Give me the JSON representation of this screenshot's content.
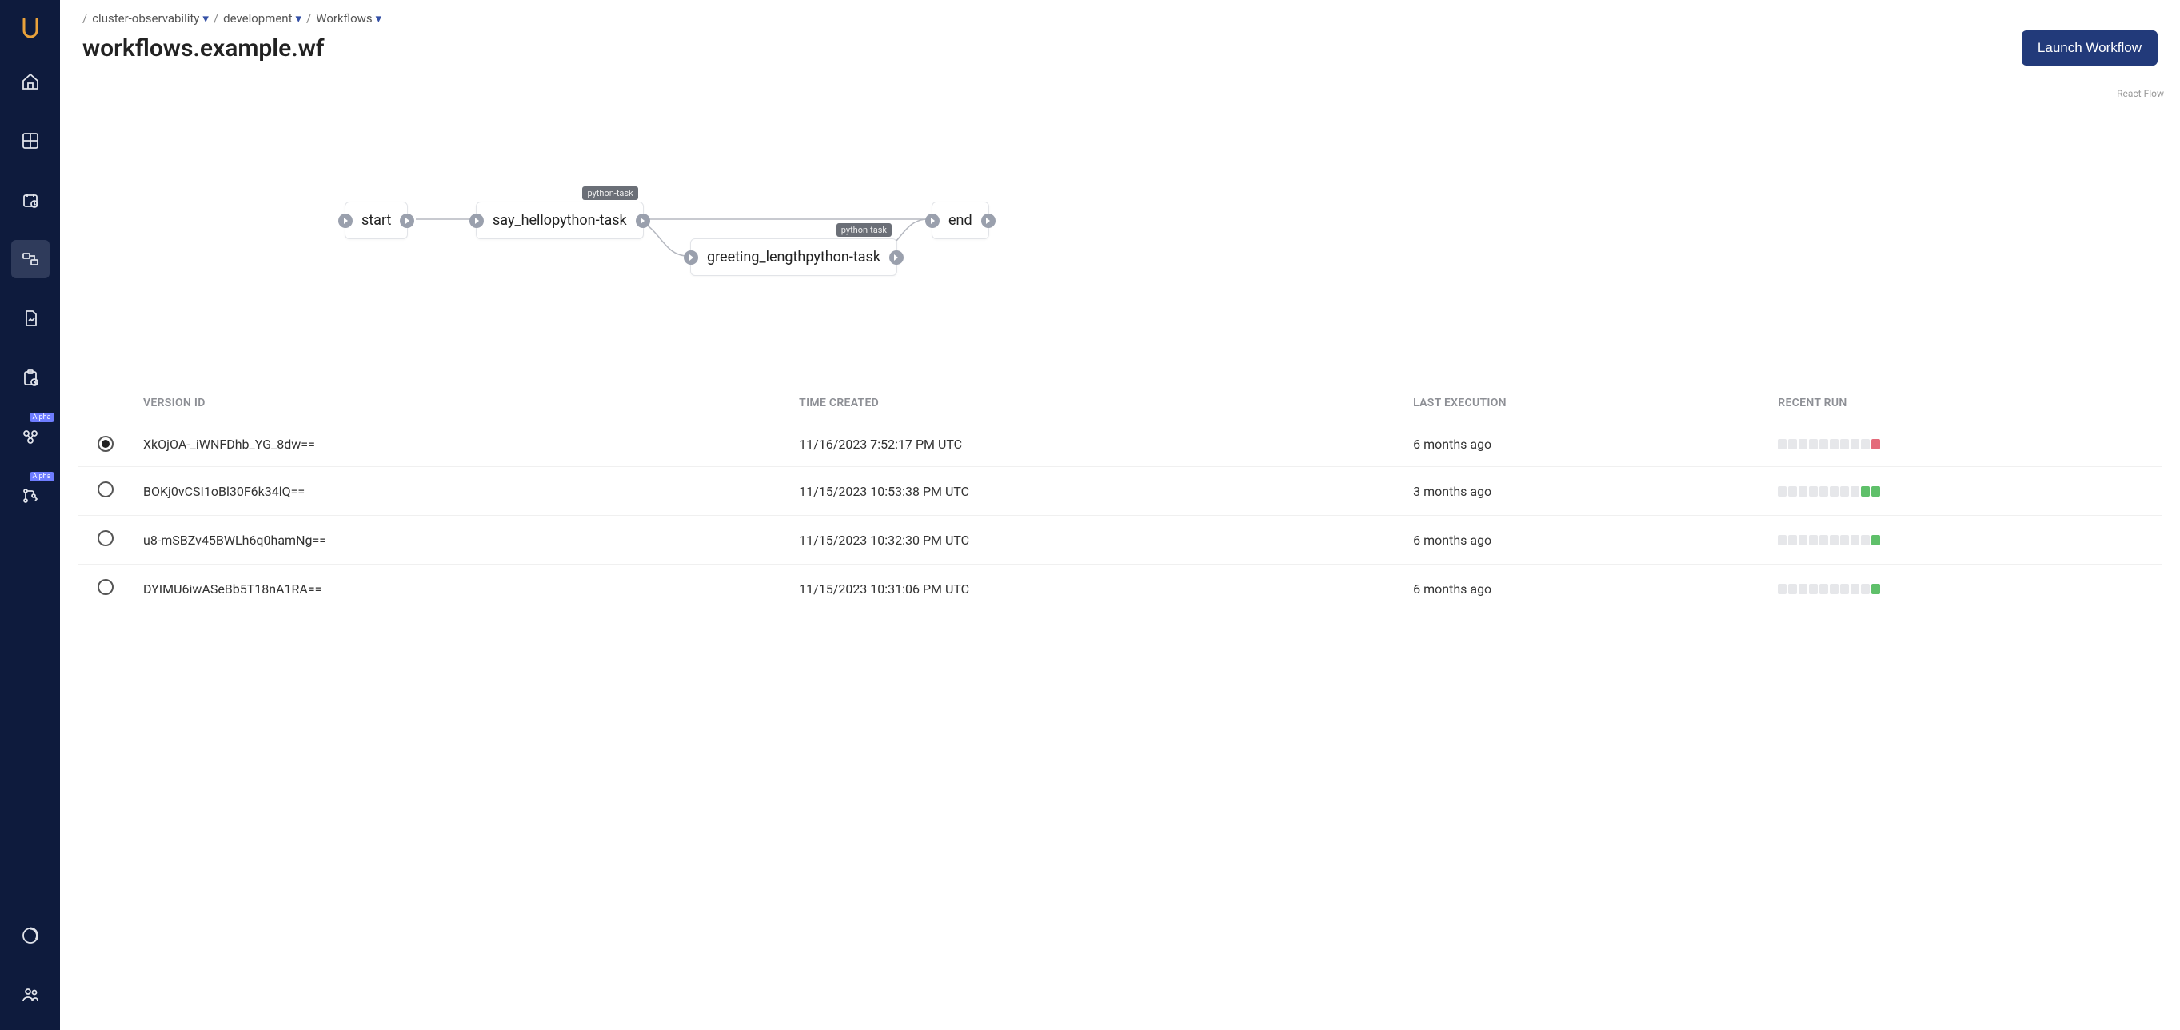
{
  "sidebar": {
    "alpha_badge": "Alpha"
  },
  "breadcrumb": {
    "sep": "/",
    "items": [
      {
        "label": "cluster-observability",
        "dropdown": true
      },
      {
        "label": "development",
        "dropdown": true
      },
      {
        "label": "Workflows",
        "dropdown": true
      }
    ]
  },
  "header": {
    "title": "workflows.example.wf",
    "launch_label": "Launch Workflow"
  },
  "graph": {
    "attribution": "React Flow",
    "tag_label": "python-task",
    "nodes": {
      "start": {
        "label": "start"
      },
      "say_hello": {
        "label": "say_hellopython-task"
      },
      "greeting_length": {
        "label": "greeting_lengthpython-task"
      },
      "end": {
        "label": "end"
      }
    }
  },
  "table": {
    "headers": {
      "version_id": "VERSION ID",
      "time_created": "TIME CREATED",
      "last_execution": "LAST EXECUTION",
      "recent_run": "RECENT RUN"
    },
    "rows": [
      {
        "selected": true,
        "version_id": "XkOjOA-_iWNFDhb_YG_8dw==",
        "time_created": "11/16/2023 7:52:17 PM UTC",
        "last_execution": "6 months ago",
        "runs": [
          "",
          "",
          "",
          "",
          "",
          "",
          "",
          "",
          "",
          "red"
        ]
      },
      {
        "selected": false,
        "version_id": "BOKj0vCSI1oBl30F6k34lQ==",
        "time_created": "11/15/2023 10:53:38 PM UTC",
        "last_execution": "3 months ago",
        "runs": [
          "",
          "",
          "",
          "",
          "",
          "",
          "",
          "",
          "green",
          "green"
        ]
      },
      {
        "selected": false,
        "version_id": "u8-mSBZv45BWLh6q0hamNg==",
        "time_created": "11/15/2023 10:32:30 PM UTC",
        "last_execution": "6 months ago",
        "runs": [
          "",
          "",
          "",
          "",
          "",
          "",
          "",
          "",
          "",
          "green"
        ]
      },
      {
        "selected": false,
        "version_id": "DYIMU6iwASeBb5T18nA1RA==",
        "time_created": "11/15/2023 10:31:06 PM UTC",
        "last_execution": "6 months ago",
        "runs": [
          "",
          "",
          "",
          "",
          "",
          "",
          "",
          "",
          "",
          "green"
        ]
      }
    ]
  }
}
